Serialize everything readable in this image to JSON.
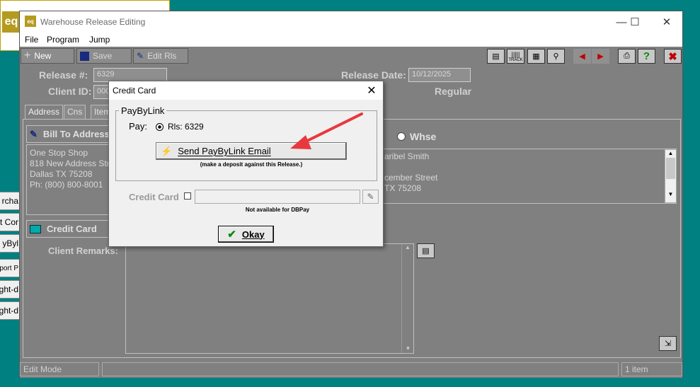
{
  "bg_window": {
    "logo": "eq"
  },
  "side_buttons": [
    "rcha",
    "t Cor",
    "yByl",
    "port P",
    "ght-d",
    "ght-d"
  ],
  "window": {
    "title": "Warehouse Release Editing",
    "icon": "eq",
    "controls": {
      "minimize": "—",
      "maximize": "☐",
      "close": "✕"
    }
  },
  "menu": [
    "File",
    "Program",
    "Jump"
  ],
  "toolbar": {
    "new_label": "New",
    "save_label": "Save",
    "edit_label": "Edit Rls",
    "track_label": "TRACK",
    "help_label": "?"
  },
  "header": {
    "release_label": "Release #:",
    "release_value": "6329",
    "client_label": "Client ID:",
    "client_value": "000",
    "release_date_label": "Release Date:",
    "release_date_value": "10/12/2025",
    "type_value": "Regular"
  },
  "tabs": [
    "Address",
    "Cns",
    "Item"
  ],
  "bill_to": {
    "header": "Bill To Address",
    "lines": [
      "One Stop Shop",
      "818 New Address Stre",
      "Dallas  TX    75208",
      "Ph: (800) 800-8001"
    ]
  },
  "ship_to": {
    "whse_label": "Whse",
    "lines": [
      "aribel Smith",
      "",
      "cember Street",
      "TX    75208"
    ]
  },
  "credit_card_section": {
    "header": "Credit Card"
  },
  "client_remarks_label": "Client Remarks:",
  "status": {
    "mode": "Edit Mode",
    "count": "1 item"
  },
  "dialog": {
    "title": "Credit Card",
    "group_label": "PayByLink",
    "pay_label": "Pay:",
    "pay_option": "Rls: 6329",
    "send_button": "Send PayByLink Email",
    "send_note": "(make a deposit against this Release.)",
    "credit_card_label": "Credit Card",
    "not_available": "Not available for DBPay",
    "ok_button": "Okay"
  },
  "colors": {
    "annotation_arrow": "#e8383d",
    "background": "#008080",
    "window": "#808080"
  }
}
